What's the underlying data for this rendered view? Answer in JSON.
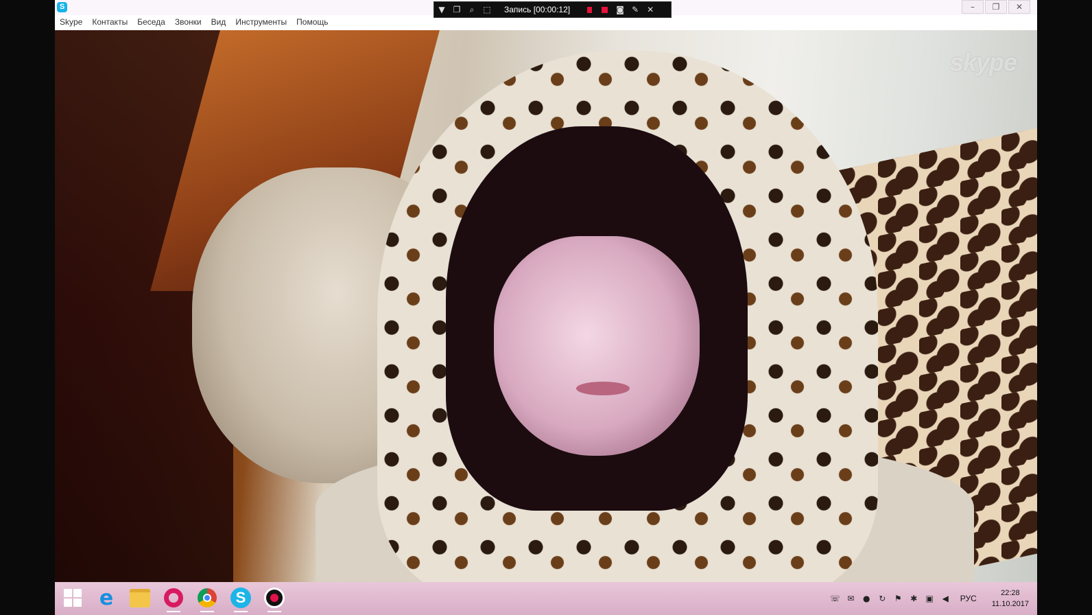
{
  "window": {
    "app_name": "Skype",
    "logo_letter": "S",
    "controls": [
      "–",
      "❐",
      "✕"
    ]
  },
  "recorder": {
    "label": "Запись [00:00:12]",
    "icons": [
      "dropdown-icon",
      "window-icon",
      "zoom-icon",
      "region-icon",
      "pause-icon",
      "stop-icon",
      "camera-icon",
      "pen-icon",
      "close-icon"
    ]
  },
  "menu": [
    "Skype",
    "Контакты",
    "Беседа",
    "Звонки",
    "Вид",
    "Инструменты",
    "Помощь"
  ],
  "video": {
    "watermark": "skype"
  },
  "taskbar": {
    "apps": [
      "start",
      "internet-explorer",
      "file-explorer",
      "opera",
      "chrome",
      "skype",
      "screen-recorder"
    ],
    "language": "РУС",
    "time": "22:28",
    "date": "11.10.2017"
  },
  "colors": {
    "skype_blue": "#18b3e8",
    "record_red": "#e8113a",
    "taskbar_pink": "#e0bbd0"
  }
}
